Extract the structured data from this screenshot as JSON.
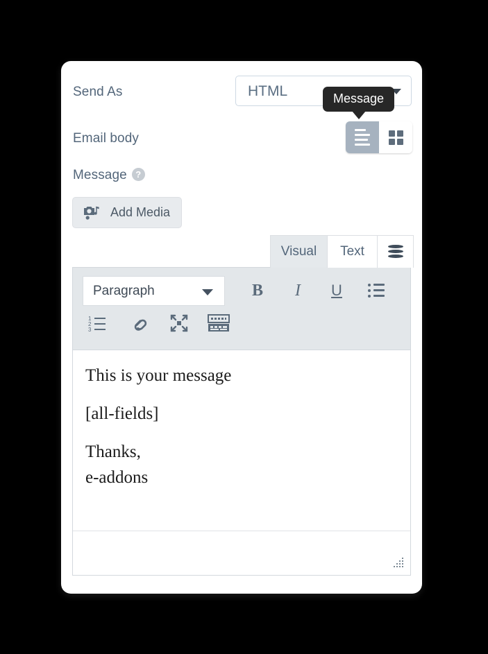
{
  "form": {
    "send_as": {
      "label": "Send As",
      "value": "HTML",
      "caret_icon": "chevron-down-icon"
    },
    "email_body": {
      "label": "Email body",
      "modes": [
        {
          "name": "message-mode",
          "icon": "text-lines-icon",
          "active": true
        },
        {
          "name": "template-mode",
          "icon": "grid-icon",
          "active": false
        }
      ]
    },
    "message": {
      "label": "Message",
      "help_icon": "question-mark-icon",
      "help_glyph": "?"
    }
  },
  "tooltip": {
    "text": "Message"
  },
  "add_media": {
    "label": "Add Media",
    "icon": "camera-music-icon"
  },
  "editor": {
    "tabs": [
      {
        "label": "Visual",
        "name": "tab-visual",
        "active": true
      },
      {
        "label": "Text",
        "name": "tab-text",
        "active": false
      },
      {
        "label": "",
        "name": "tab-database",
        "icon": "database-icon",
        "active": false
      }
    ],
    "toolbar": {
      "format_select": {
        "value": "Paragraph",
        "caret_icon": "chevron-down-icon"
      },
      "buttons": [
        {
          "name": "bold-button",
          "glyph": "B",
          "title": "Bold"
        },
        {
          "name": "italic-button",
          "glyph": "I",
          "title": "Italic"
        },
        {
          "name": "underline-button",
          "glyph": "U",
          "title": "Underline"
        },
        {
          "name": "bulleted-list-button",
          "icon": "bulleted-list-icon"
        },
        {
          "name": "numbered-list-button",
          "icon": "numbered-list-icon"
        },
        {
          "name": "insert-link-button",
          "icon": "link-icon"
        },
        {
          "name": "fullscreen-button",
          "icon": "expand-icon"
        },
        {
          "name": "keyboard-shortcuts-button",
          "icon": "keyboard-icon"
        }
      ],
      "list_numbers": [
        "1",
        "2",
        "3"
      ]
    },
    "content": {
      "lines": [
        "This is your message",
        "[all-fields]",
        "Thanks,",
        "e-addons"
      ]
    },
    "resize_handle_icon": "resize-grip-icon"
  },
  "colors": {
    "background": "#000000",
    "card": "#ffffff",
    "label_text": "#53667a",
    "tooltip_bg": "#272727",
    "toggle_active": "#a6b2bf",
    "toolbar_bg": "#e3e7ea",
    "tab_active_bg": "#e5e9ec",
    "button_bg": "#e8ebee",
    "border": "#d3d8dd"
  }
}
